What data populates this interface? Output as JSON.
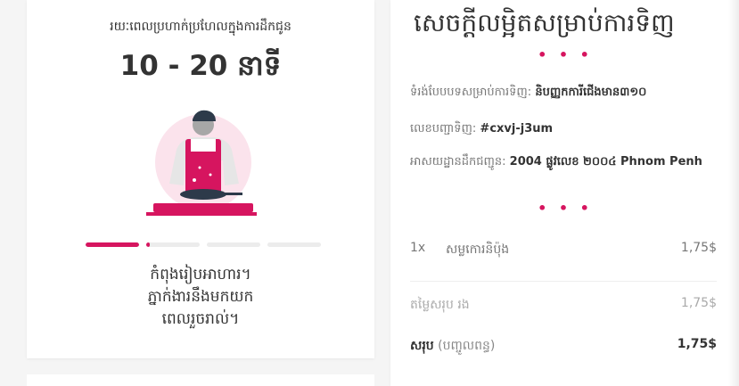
{
  "left": {
    "eta_label": "រយៈពេលប្រហាក់ប្រហែលក្នុងការដឹកជូន",
    "eta_value": "10 - 20 នាទី",
    "progress": [
      1.0,
      0.05,
      0.0,
      0.0
    ],
    "status_lines": [
      "កំពុងរៀបអាហារ។",
      "ភ្នាក់ងារនឹងមកយក",
      "ពេលរួចរាល់។"
    ]
  },
  "right": {
    "title": "សេចក្ដីលម្អិតសម្រាប់ការទិញ",
    "dots": "• • •",
    "order_type_label": "ទំរង់បែបបទសម្រាប់ការទិញ:",
    "order_type_value": "និបញ្ញកការីជើងមាន៣១០",
    "order_number_label": "លេខបញ្ជាទិញ:",
    "order_number_value": "#cxvj-j3um",
    "address_label": "អាសយដ្ឋានដឹកជញ្ជូន:",
    "address_value": "2004 ផ្លូវលេខ ២០០៤ Phnom Penh",
    "item": {
      "qty": "1x",
      "name": "សម្លកោរនិប៉ុង",
      "price": "1,75$"
    },
    "subtotal": {
      "label": "តម្លៃសរុប រង",
      "price": "1,75$"
    },
    "total": {
      "label": "សរុប",
      "note": "(បញ្ចូលពន្ធ)",
      "price": "1,75$"
    }
  },
  "colors": {
    "accent": "#d6155f"
  }
}
